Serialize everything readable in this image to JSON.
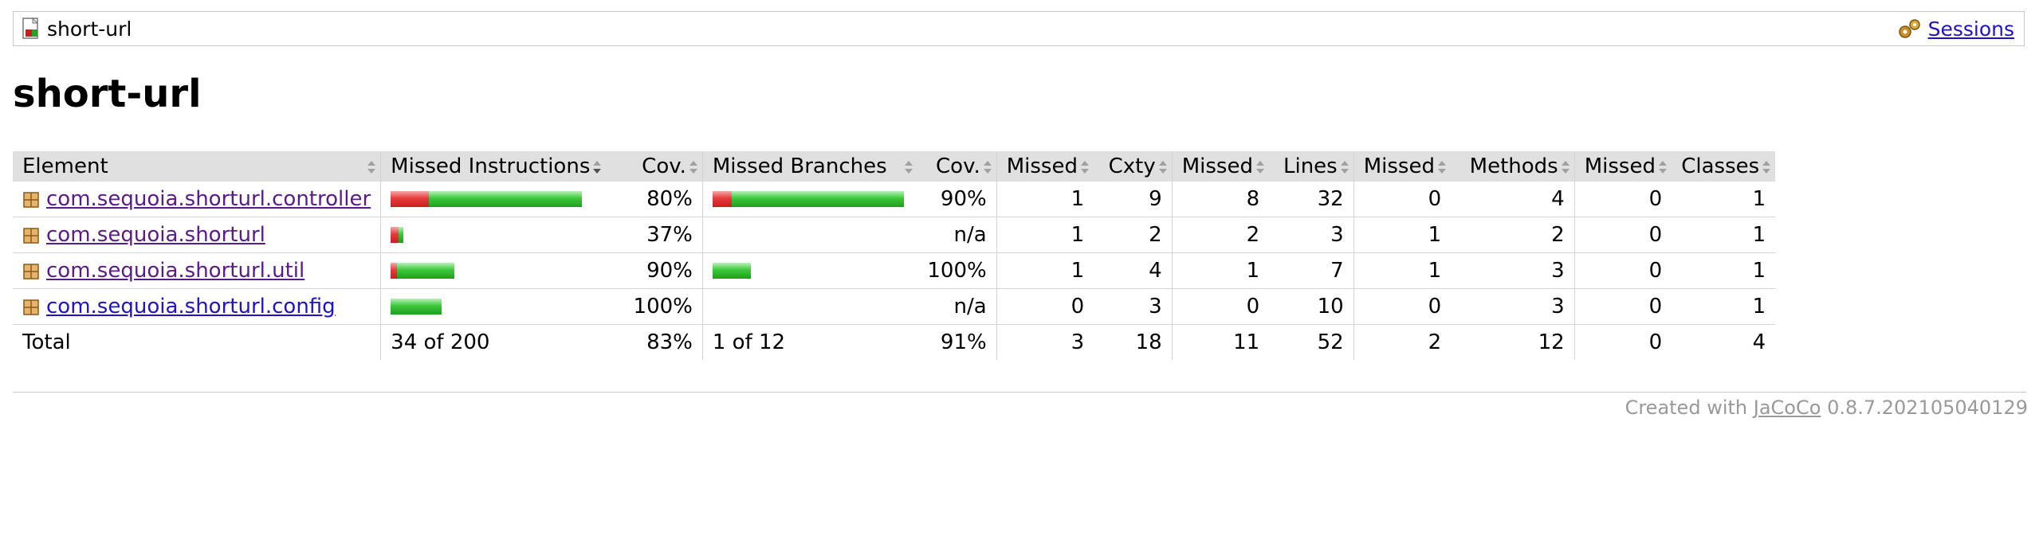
{
  "breadcrumb": {
    "report_name": "short-url",
    "sessions_label": "Sessions"
  },
  "title": "short-url",
  "table": {
    "headers": {
      "element": "Element",
      "missed_instructions": "Missed Instructions",
      "cov_instructions": "Cov.",
      "missed_branches": "Missed Branches",
      "cov_branches": "Cov.",
      "missed_cxty": "Missed",
      "cxty": "Cxty",
      "missed_lines": "Missed",
      "lines": "Lines",
      "missed_methods": "Missed",
      "methods": "Methods",
      "missed_classes": "Missed",
      "classes": "Classes"
    },
    "rows": [
      {
        "name": "com.sequoia.shorturl.controller",
        "instr_missed_ratio": 0.2,
        "instr_total": 120,
        "instr_cov": "80%",
        "branch_missed_ratio": 0.1,
        "branch_total": 10,
        "branch_cov": "90%",
        "missed_cxty": "1",
        "cxty": "9",
        "missed_lines": "8",
        "lines": "32",
        "missed_methods": "0",
        "methods": "4",
        "missed_classes": "0",
        "classes": "1"
      },
      {
        "name": "com.sequoia.shorturl",
        "instr_missed_ratio": 0.63,
        "instr_total": 8,
        "instr_cov": "37%",
        "branch_missed_ratio": null,
        "branch_total": 0,
        "branch_cov": "n/a",
        "missed_cxty": "1",
        "cxty": "2",
        "missed_lines": "2",
        "lines": "3",
        "missed_methods": "1",
        "methods": "2",
        "missed_classes": "0",
        "classes": "1"
      },
      {
        "name": "com.sequoia.shorturl.util",
        "instr_missed_ratio": 0.1,
        "instr_total": 40,
        "instr_cov": "90%",
        "branch_missed_ratio": 0.0,
        "branch_total": 2,
        "branch_cov": "100%",
        "missed_cxty": "1",
        "cxty": "4",
        "missed_lines": "1",
        "lines": "7",
        "missed_methods": "1",
        "methods": "3",
        "missed_classes": "0",
        "classes": "1"
      },
      {
        "name": "com.sequoia.shorturl.config",
        "instr_missed_ratio": 0.0,
        "instr_total": 32,
        "instr_cov": "100%",
        "branch_missed_ratio": null,
        "branch_total": 0,
        "branch_cov": "n/a",
        "missed_cxty": "0",
        "cxty": "3",
        "missed_lines": "0",
        "lines": "10",
        "missed_methods": "0",
        "methods": "3",
        "missed_classes": "0",
        "classes": "1"
      }
    ],
    "total": {
      "label": "Total",
      "instr": "34 of 200",
      "instr_cov": "83%",
      "branch": "1 of 12",
      "branch_cov": "91%",
      "missed_cxty": "3",
      "cxty": "18",
      "missed_lines": "11",
      "lines": "52",
      "missed_methods": "2",
      "methods": "12",
      "missed_classes": "0",
      "classes": "4"
    }
  },
  "footer": {
    "prefix": "Created with",
    "tool_link": "JaCoCo",
    "version": "0.8.7.202105040129"
  },
  "colors": {
    "bar_missed": "#e63b3b",
    "bar_covered": "#3cc83c",
    "header_bg": "#e0e0e0",
    "link": "#1f12c9",
    "visited_link": "#5a1a8a"
  }
}
